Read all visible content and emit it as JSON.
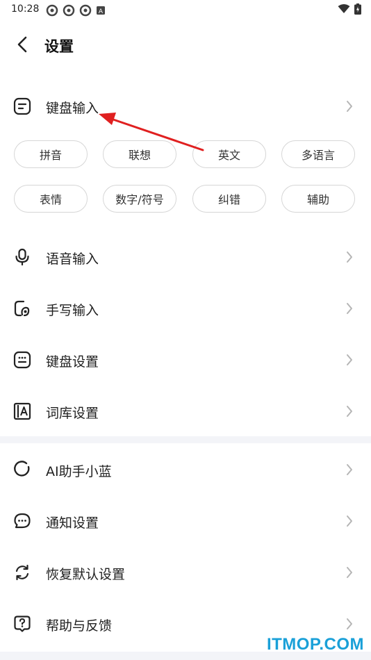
{
  "status_bar": {
    "time": "10:28"
  },
  "header": {
    "title": "设置"
  },
  "keyboard_section": {
    "label": "键盘输入",
    "chips_row1": [
      "拼音",
      "联想",
      "英文",
      "多语言"
    ],
    "chips_row2": [
      "表情",
      "数字/符号",
      "纠错",
      "辅助"
    ]
  },
  "menu_group1": [
    {
      "label": "语音输入",
      "icon": "microphone-icon"
    },
    {
      "label": "手写输入",
      "icon": "handwriting-icon"
    },
    {
      "label": "键盘设置",
      "icon": "keyboard-icon"
    },
    {
      "label": "词库设置",
      "icon": "dictionary-icon"
    }
  ],
  "menu_group2": [
    {
      "label": "AI助手小蓝",
      "icon": "ai-assistant-icon"
    },
    {
      "label": "通知设置",
      "icon": "notification-icon"
    },
    {
      "label": "恢复默认设置",
      "icon": "reset-icon"
    },
    {
      "label": "帮助与反馈",
      "icon": "help-icon"
    }
  ],
  "colors": {
    "annotation_arrow": "#e02020",
    "watermark": "#1aa0d8",
    "divider": "#f3f4f8"
  },
  "watermark": "ITMOP.COM"
}
